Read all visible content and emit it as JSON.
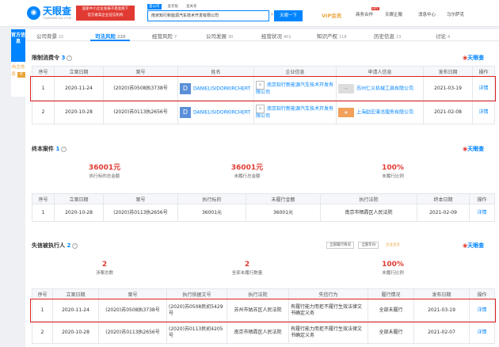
{
  "header": {
    "logo": "天眼查",
    "logo_sub": "TIANYANCHA.COM",
    "promo_line1": "国家中小企业发展子基金旗下",
    "promo_line2": "官方备案企业征信机构",
    "search_tabs": [
      "查公司",
      "查老板",
      "查关系"
    ],
    "search_value": "南京知行新能源汽车技术开发有限公司",
    "search_button": "天眼一下",
    "vip": "VIP会员",
    "hot": "HOT",
    "nav": [
      "商务合作",
      "天眼企服",
      "消息中心",
      "马尔萨克"
    ]
  },
  "sidebar": {
    "official": "官方信息",
    "self_risk": "自主信息",
    "self_risk_count": "4"
  },
  "tabs": [
    {
      "label": "公司背景",
      "count": "22"
    },
    {
      "label": "司法风险",
      "count": "220"
    },
    {
      "label": "经营风险",
      "count": "7"
    },
    {
      "label": "公司发展",
      "count": "30"
    },
    {
      "label": "经营状况",
      "count": "401"
    },
    {
      "label": "知识产权",
      "count": "118"
    },
    {
      "label": "历史信息",
      "count": "13"
    },
    {
      "label": "讨论",
      "count": "4"
    }
  ],
  "brand": "天眼查",
  "consumption": {
    "title": "限制消费令",
    "count": "3",
    "columns": [
      "序号",
      "立案日期",
      "案号",
      "姓名",
      "企业信息",
      "申请人信息",
      "发布日期",
      "操作"
    ],
    "rows": [
      {
        "no": "1",
        "date": "2020-11-24",
        "case": "(2020)苏0508执3738号",
        "badge": "D",
        "name": "DANIELISIDORKIRCHERT",
        "company": "南京知行新能源汽车技术开发有限公司",
        "applicant": "苏州仁义机械工具有限公司",
        "publish": "2021-03-19",
        "action": "详情"
      },
      {
        "no": "2",
        "date": "2020-10-28",
        "case": "(2020)苏0113执2656号",
        "badge": "D",
        "name": "DANIELISIDORKIRCHERT",
        "company": "南京知行新能源汽车技术开发有限公司",
        "applicant": "上海励宏清洁服务有限公司",
        "publish": "2021-02-08",
        "action": "详情"
      }
    ]
  },
  "final_cases": {
    "title": "终本案件",
    "count": "1",
    "stats": [
      {
        "value": "36001元",
        "label": "执行标的总金额"
      },
      {
        "value": "36001元",
        "label": "未履行总金额"
      },
      {
        "value": "100%",
        "label": "未履行比例"
      }
    ],
    "columns": [
      "序号",
      "立案日期",
      "案号",
      "执行标的",
      "未履行金额",
      "执行法院",
      "终本日期",
      "操作"
    ],
    "rows": [
      {
        "no": "1",
        "date": "2020-10-28",
        "case": "(2020)苏0113执2656号",
        "target": "36001元",
        "unpaid": "36001元",
        "court": "南京市栖霞区人民法院",
        "end": "2021-02-09",
        "action": "详情"
      }
    ]
  },
  "dishonest": {
    "title": "失信被执行人",
    "count": "2",
    "filters": [
      "全部履行情况",
      "全部年份",
      "企业主页"
    ],
    "stats": [
      {
        "value": "2",
        "label": "涉案总数"
      },
      {
        "value": "2",
        "label": "全部未履行数量"
      },
      {
        "value": "100%",
        "label": "未履行比例"
      }
    ],
    "columns": [
      "序号",
      "立案日期",
      "案号",
      "执行依据文号",
      "执行法院",
      "失信行为",
      "履行情况",
      "发布日期",
      "操作"
    ],
    "rows": [
      {
        "no": "1",
        "date": "2020-11-24",
        "case": "(2020)苏0508执3738号",
        "basis": "(2020)苏0508民初5429号",
        "court": "苏州市姑苏区人民法院",
        "behavior": "有履行能力而拒不履行生效法律文书确定义务",
        "status": "全部未履行",
        "publish": "2021-03-19",
        "action": "详情"
      },
      {
        "no": "2",
        "date": "2020-10-28",
        "case": "(2020)苏0113执2656号",
        "basis": "(2020)苏0113民初4205号",
        "court": "南京市栖霞区人民法院",
        "behavior": "有履行能力而拒不履行生效法律文书确定义务",
        "status": "全部未履行",
        "publish": "2021-02-07",
        "action": "详情"
      }
    ]
  }
}
